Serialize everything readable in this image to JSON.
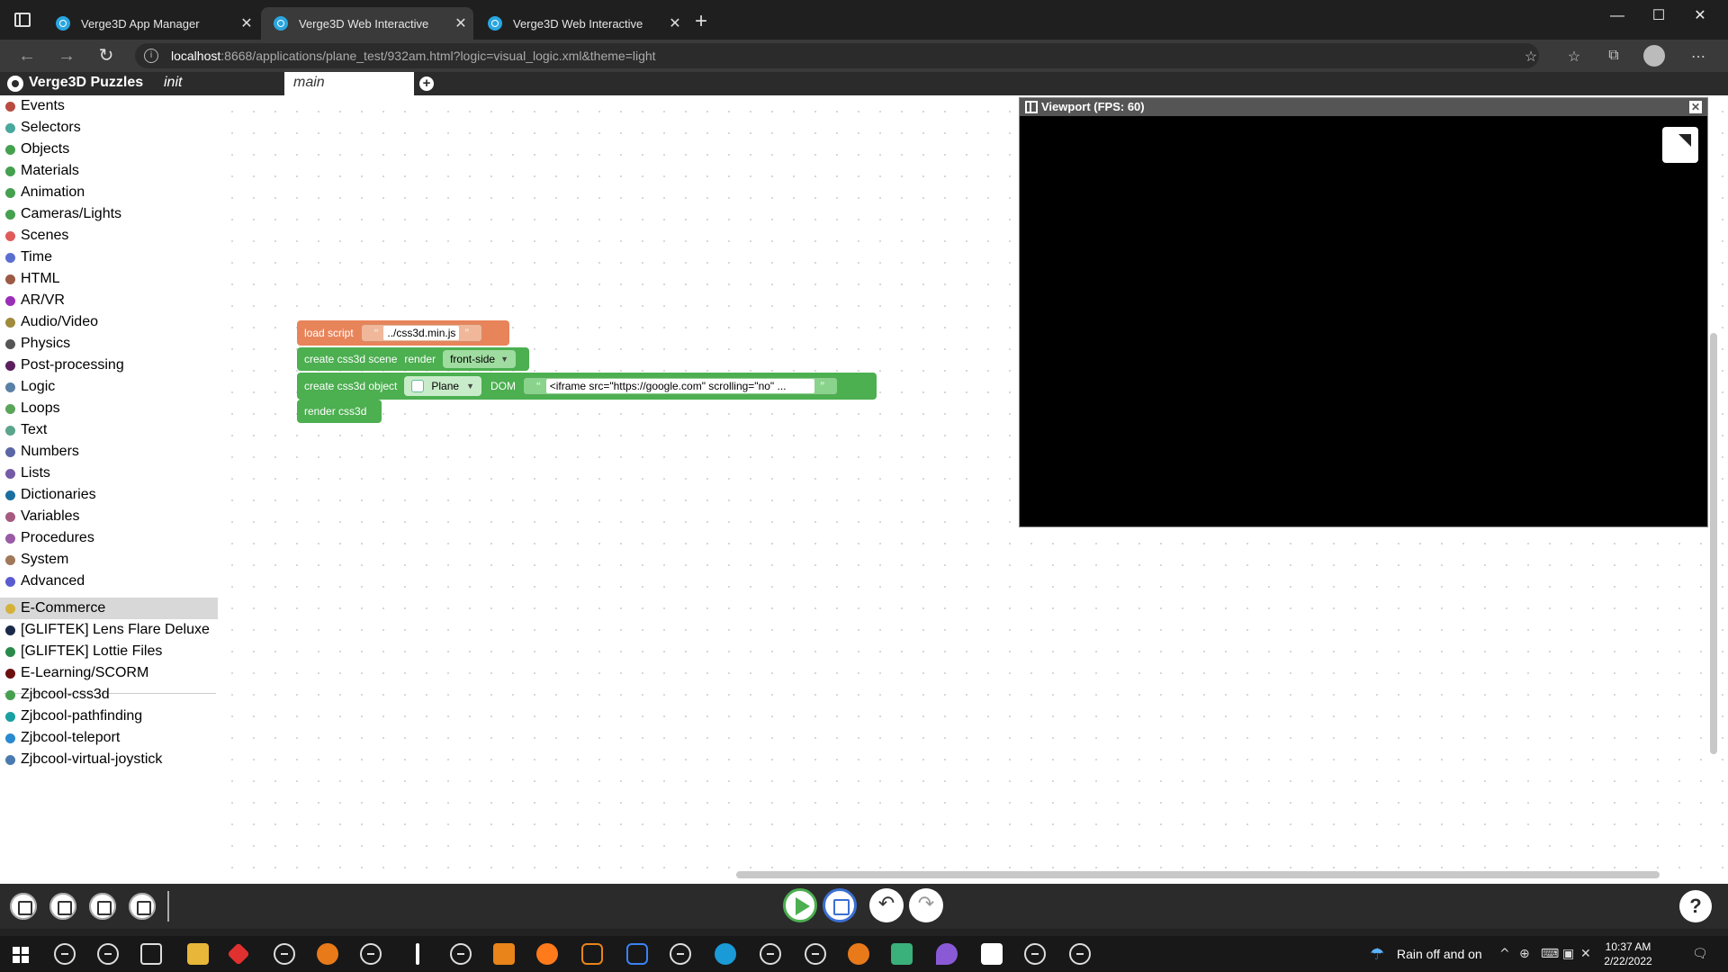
{
  "browser": {
    "tabs": [
      {
        "title": "Verge3D App Manager",
        "close": "✕"
      },
      {
        "title": "Verge3D Web Interactive",
        "close": "✕"
      },
      {
        "title": "Verge3D Web Interactive",
        "close": "✕"
      }
    ],
    "new_tab": "+",
    "window": {
      "minimize": "—",
      "maximize": "☐",
      "close": "✕"
    },
    "url_host": "localhost",
    "url_rest": ":8668/applications/plane_test/932am.html?logic=visual_logic.xml&theme=light",
    "info_glyph": "i"
  },
  "puzzles": {
    "app_title": "Verge3D Puzzles",
    "tab_init": "init",
    "tab_main": "main",
    "add_tab": "+"
  },
  "categories": [
    {
      "label": "Events",
      "color": "#b94b41"
    },
    {
      "label": "Selectors",
      "color": "#49a89d"
    },
    {
      "label": "Objects",
      "color": "#45a050"
    },
    {
      "label": "Materials",
      "color": "#45a050"
    },
    {
      "label": "Animation",
      "color": "#45a050"
    },
    {
      "label": "Cameras/Lights",
      "color": "#45a050"
    },
    {
      "label": "Scenes",
      "color": "#e05a5a"
    },
    {
      "label": "Time",
      "color": "#5b6fd1"
    },
    {
      "label": "HTML",
      "color": "#9c5b45"
    },
    {
      "label": "AR/VR",
      "color": "#9a2fb7"
    },
    {
      "label": "Audio/Video",
      "color": "#a08a3c"
    },
    {
      "label": "Physics",
      "color": "#555555"
    },
    {
      "label": "Post-processing",
      "color": "#5b1f5e"
    },
    {
      "label": "Logic",
      "color": "#5b80a5"
    },
    {
      "label": "Loops",
      "color": "#5ba55b"
    },
    {
      "label": "Text",
      "color": "#5ba58c"
    },
    {
      "label": "Numbers",
      "color": "#5b67a5"
    },
    {
      "label": "Lists",
      "color": "#745ba5"
    },
    {
      "label": "Dictionaries",
      "color": "#1a6fa0"
    },
    {
      "label": "Variables",
      "color": "#a55b80"
    },
    {
      "label": "Procedures",
      "color": "#995ba5"
    },
    {
      "label": "System",
      "color": "#a0785a"
    },
    {
      "label": "Advanced",
      "color": "#5b5bd1"
    },
    {
      "label": "E-Commerce",
      "color": "#d4b23a"
    },
    {
      "label": "[GLIFTEK] Lens Flare Deluxe",
      "color": "#1c2a4a"
    },
    {
      "label": "[GLIFTEK] Lottie Files",
      "color": "#2a8a4a"
    },
    {
      "label": "E-Learning/SCORM",
      "color": "#6b1010"
    },
    {
      "label": "Zjbcool-css3d",
      "color": "#45a050"
    },
    {
      "label": "Zjbcool-pathfinding",
      "color": "#1aa0a0"
    },
    {
      "label": "Zjbcool-teleport",
      "color": "#2a8ad0"
    },
    {
      "label": "Zjbcool-virtual-joystick",
      "color": "#4a7ab0"
    }
  ],
  "blocks": {
    "load_script": {
      "label": "load script",
      "value": "../css3d.min.js",
      "color": "#e8845a"
    },
    "create_scene": {
      "label": "create css3d scene",
      "render_label": "render",
      "render_value": "front-side",
      "color": "#4caf50"
    },
    "create_object": {
      "label": "create css3d object",
      "object": "Plane",
      "dom_label": "DOM",
      "dom_value": "<iframe src=\"https://google.com\" scrolling=\"no\" ...",
      "color": "#4caf50"
    },
    "render": {
      "label": "render css3d",
      "color": "#4caf50"
    },
    "quote_open": "“",
    "quote_close": "”",
    "caret": "▼"
  },
  "viewport": {
    "title": "Viewport (FPS: 60)",
    "close": "✕"
  },
  "toolbar": {
    "undo": "↶",
    "redo": "↷",
    "help": "?"
  },
  "taskbar": {
    "weather": "Rain off and on",
    "time": "10:37 AM",
    "date": "2/22/2022",
    "tray_up": "^",
    "notification": "🗨"
  }
}
